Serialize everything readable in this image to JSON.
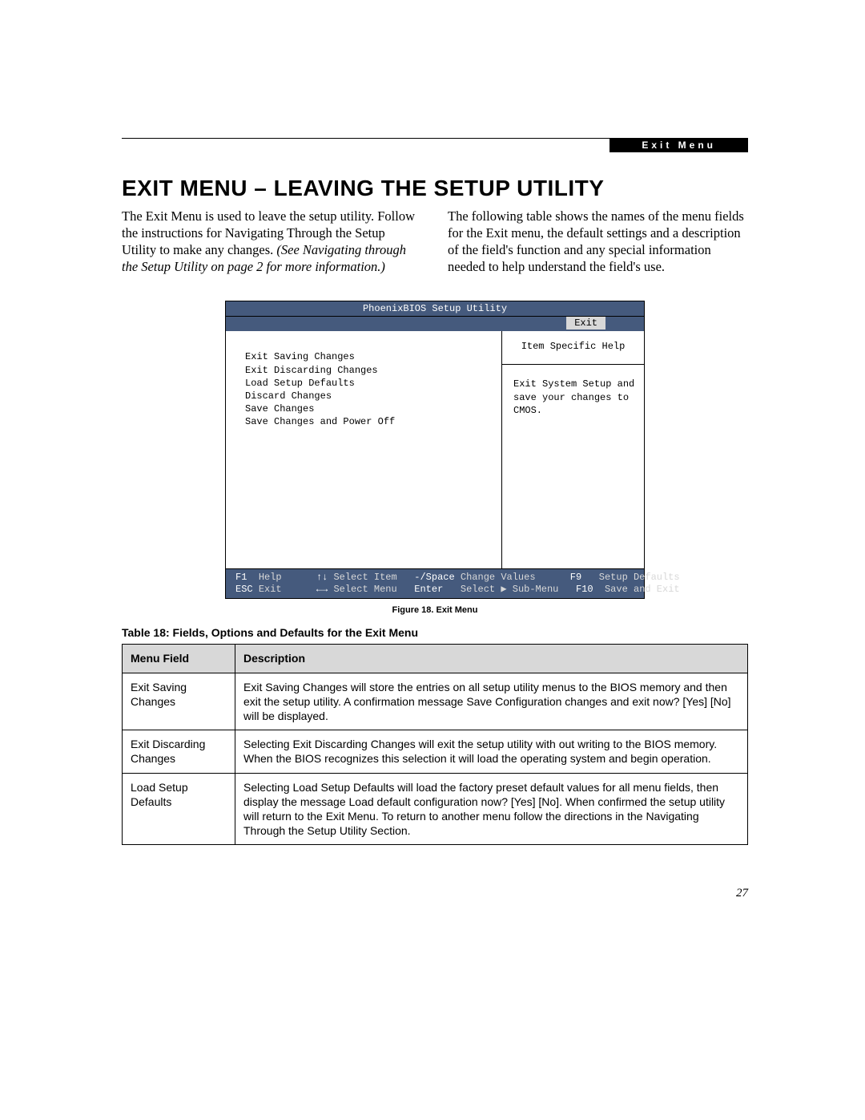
{
  "header": {
    "section_tag": "Exit Menu",
    "title": "EXIT MENU – LEAVING THE SETUP UTILITY"
  },
  "intro": {
    "col1a": "The Exit Menu is used to leave the setup utility. Follow the instructions for Navigating Through the Setup Utility to make any changes. ",
    "col1b": "(See Navigating through the Setup Utility on page 2 for more information.)",
    "col2": "The following table shows the names of the menu fields for the Exit menu, the default settings and a description of the field's function and any special information needed to help understand the field's use."
  },
  "bios": {
    "title": "PhoenixBIOS Setup Utility",
    "active_tab": "Exit",
    "menu_items": [
      "Exit Saving Changes",
      "Exit Discarding Changes",
      "Load Setup Defaults",
      "Discard Changes",
      "Save Changes",
      "Save Changes and Power Off"
    ],
    "help_title": "Item Specific Help",
    "help_body": "Exit System Setup and save your changes to CMOS.",
    "footer": {
      "row1": {
        "k1": "F1",
        "l1": "Help",
        "k2": "↑↓",
        "l2": "Select Item",
        "k3": "-/Space",
        "l3": "Change Values",
        "k4": "F9",
        "l4": "Setup Defaults"
      },
      "row2": {
        "k1": "ESC",
        "l1": "Exit",
        "k2": "←→",
        "l2": "Select Menu",
        "k3": "Enter",
        "l3": "Select ▶ Sub-Menu",
        "k4": "F10",
        "l4": "Save and Exit"
      }
    }
  },
  "figure_caption": "Figure 18.  Exit Menu",
  "table_caption": "Table 18: Fields, Options and Defaults for the Exit Menu",
  "table": {
    "headers": {
      "c1": "Menu Field",
      "c2": "Description"
    },
    "rows": [
      {
        "field": "Exit Saving Changes",
        "desc": "Exit Saving Changes will store the entries on all setup utility menus to the BIOS memory and then exit the setup utility. A confirmation message Save Configuration changes and exit now? [Yes] [No] will be displayed."
      },
      {
        "field": "Exit Discarding Changes",
        "desc": "Selecting Exit Discarding Changes will exit the setup utility with out writing to the BIOS memory. When the BIOS recognizes this selection it will load the operating system and begin operation."
      },
      {
        "field": "Load Setup Defaults",
        "desc": "Selecting Load Setup Defaults will load the factory preset default values for all menu fields, then display the message Load default configuration now? [Yes] [No]. When confirmed the setup utility will return to the Exit Menu. To return to another menu follow the directions in the Navigating Through the Setup Utility Section."
      }
    ]
  },
  "page_number": "27"
}
